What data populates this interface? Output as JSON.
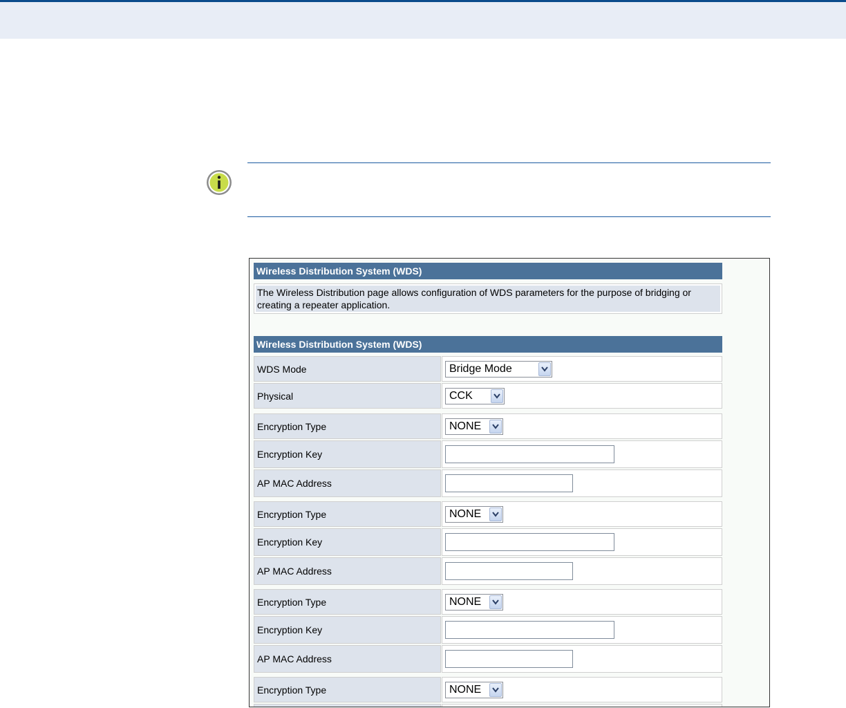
{
  "header_section": {
    "title": "Wireless Distribution System (WDS)",
    "description": "The Wireless Distribution page allows configuration of WDS parameters for the purpose of bridging or creating a repeater application."
  },
  "settings_section": {
    "title": "Wireless Distribution System (WDS)"
  },
  "wds_mode": {
    "label": "WDS Mode",
    "value": "Bridge Mode"
  },
  "physical": {
    "label": "Physical",
    "value": "CCK"
  },
  "groups": [
    {
      "encryption_type": {
        "label": "Encryption Type",
        "value": "NONE"
      },
      "encryption_key": {
        "label": "Encryption Key",
        "value": ""
      },
      "ap_mac": {
        "label": "AP MAC Address",
        "value": ""
      }
    },
    {
      "encryption_type": {
        "label": "Encryption Type",
        "value": "NONE"
      },
      "encryption_key": {
        "label": "Encryption Key",
        "value": ""
      },
      "ap_mac": {
        "label": "AP MAC Address",
        "value": ""
      }
    },
    {
      "encryption_type": {
        "label": "Encryption Type",
        "value": "NONE"
      },
      "encryption_key": {
        "label": "Encryption Key",
        "value": ""
      },
      "ap_mac": {
        "label": "AP MAC Address",
        "value": ""
      }
    },
    {
      "encryption_type": {
        "label": "Encryption Type",
        "value": "NONE"
      }
    }
  ],
  "icons": {
    "note": "info-icon",
    "dropdown": "chevron-down-icon"
  },
  "colors": {
    "header_bar": "#4b7299",
    "label_cell": "#dde3ec",
    "top_rule": "#0a4b8c",
    "info_icon_fill": "#c8dc4a"
  }
}
